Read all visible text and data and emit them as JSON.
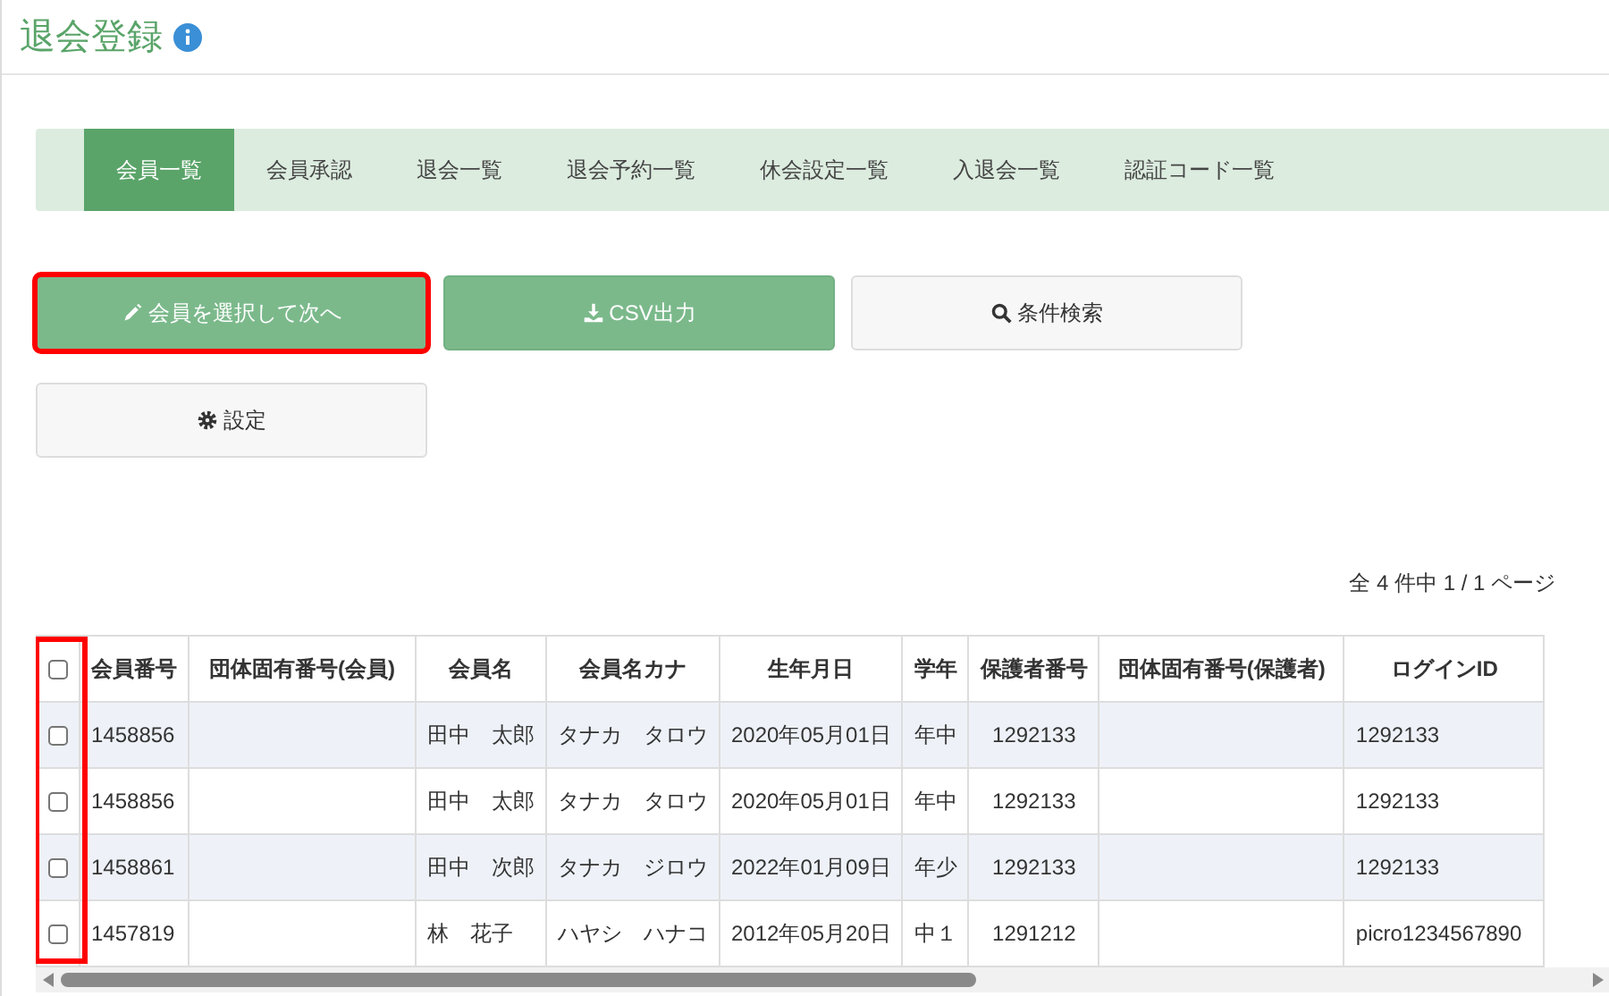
{
  "page": {
    "title": "退会登録"
  },
  "tabs": [
    {
      "label": "会員一覧",
      "selected": true
    },
    {
      "label": "会員承認",
      "selected": false
    },
    {
      "label": "退会一覧",
      "selected": false
    },
    {
      "label": "退会予約一覧",
      "selected": false
    },
    {
      "label": "休会設定一覧",
      "selected": false
    },
    {
      "label": "入退会一覧",
      "selected": false
    },
    {
      "label": "認証コード一覧",
      "selected": false
    }
  ],
  "buttons": [
    {
      "label": "会員を選択して次へ",
      "kind": "select",
      "highlighted": true
    },
    {
      "label": "CSV出力",
      "kind": "download",
      "highlighted": false
    },
    {
      "label": "条件検索",
      "kind": "search",
      "highlighted": false
    },
    {
      "label": "設定",
      "kind": "settings",
      "highlighted": false
    }
  ],
  "result_count": "全 4 件中 1 / 1 ページ",
  "table": {
    "checkbox_column_highlighted": true,
    "select_all": {
      "checked": false
    },
    "columns": [
      "会員番号",
      "団体固有番号(会員)",
      "会員名",
      "会員名カナ",
      "生年月日",
      "学年",
      "保護者番号",
      "団体固有番号(保護者)",
      "ログインID"
    ],
    "rows": [
      {
        "checked": false,
        "cells": [
          "1458856",
          "",
          "田中　太郎",
          "タナカ　タロウ",
          "2020年05月01日",
          "年中",
          "1292133",
          "",
          "1292133"
        ]
      },
      {
        "checked": false,
        "cells": [
          "1458856",
          "",
          "田中　太郎",
          "タナカ　タロウ",
          "2020年05月01日",
          "年中",
          "1292133",
          "",
          "1292133"
        ]
      },
      {
        "checked": false,
        "cells": [
          "1458861",
          "",
          "田中　次郎",
          "タナカ　ジロウ",
          "2022年01月09日",
          "年少",
          "1292133",
          "",
          "1292133"
        ]
      },
      {
        "checked": false,
        "cells": [
          "1457819",
          "",
          "林　花子",
          "ハヤシ　ハナコ",
          "2012年05月20日",
          "中１",
          "1291212",
          "",
          "picro1234567890"
        ]
      }
    ]
  }
}
